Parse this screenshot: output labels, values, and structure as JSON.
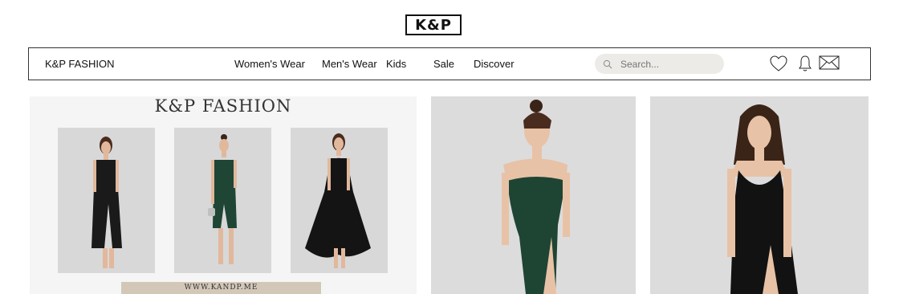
{
  "logo": {
    "text": "K&P"
  },
  "navbar": {
    "brand": "K&P FASHION",
    "links": [
      "Women's Wear",
      "Men's Wear",
      "Kids",
      "Sale",
      "Discover"
    ]
  },
  "search": {
    "placeholder": "Search..."
  },
  "icons": [
    "heart-icon",
    "bell-icon",
    "mail-icon"
  ],
  "banner": {
    "title": "K&P FASHION",
    "url": "WWW.KANDP.ME",
    "thumbnails": [
      {
        "dress_color": "#1a1a1a"
      },
      {
        "dress_color": "#1f4535"
      },
      {
        "dress_color": "#141414"
      }
    ]
  },
  "products": [
    {
      "dress_color": "#1e4434"
    },
    {
      "dress_color": "#121212"
    }
  ],
  "colors": {
    "background": "#ffffff",
    "search_bg": "#ecebe7",
    "url_bar": "#d3c7b8",
    "photo_bg": "#dcdcdc"
  }
}
